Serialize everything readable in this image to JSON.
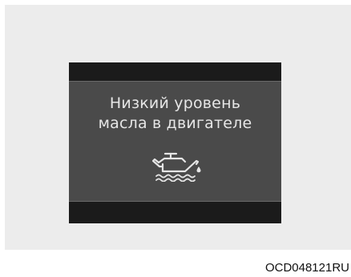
{
  "display": {
    "message_line1": "Низкий уровень",
    "message_line2": "масла в двигателе",
    "icon": "oil-can-level-icon",
    "screen_color": "#4a4a4a",
    "frame_color": "#1b1b1b",
    "text_color": "#e6e6e6"
  },
  "caption": {
    "code": "OCD048121RU"
  }
}
